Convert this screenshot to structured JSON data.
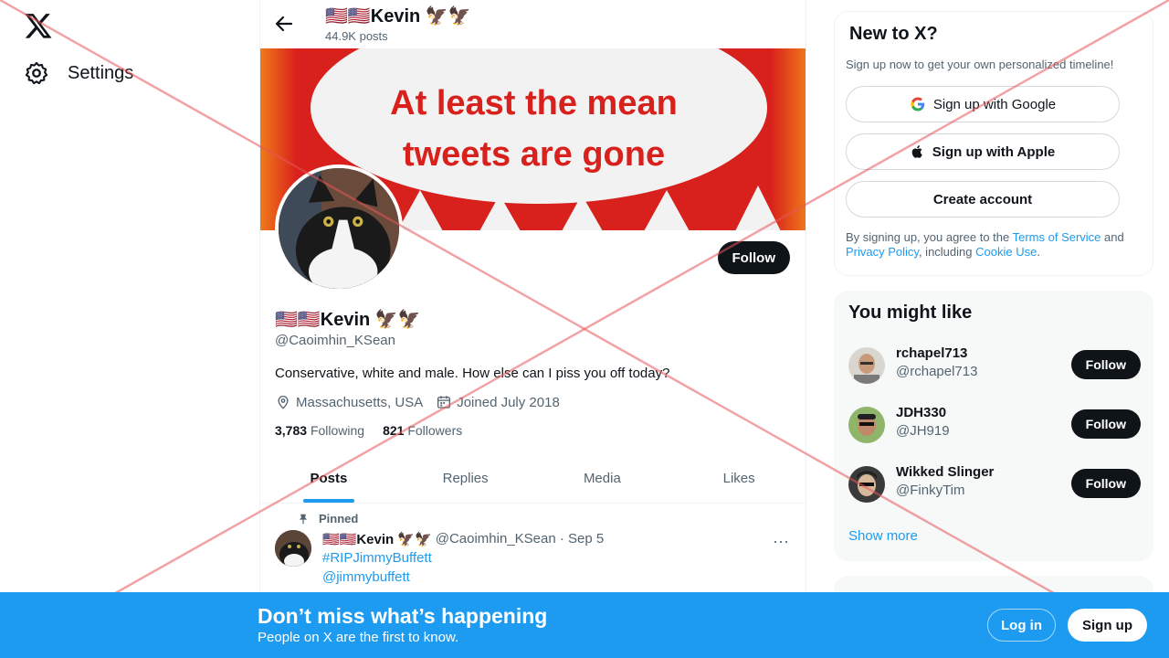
{
  "nav": {
    "settings_label": "Settings"
  },
  "header": {
    "display_name": "🇺🇸🇺🇸Kevin 🦅🦅",
    "posts_count": "44.9K posts"
  },
  "banner": {
    "text_line1": "At least the mean",
    "text_line2": "tweets are gone"
  },
  "profile": {
    "follow_label": "Follow",
    "display_name": "🇺🇸🇺🇸Kevin 🦅🦅",
    "handle": "@Caoimhin_KSean",
    "bio": "Conservative, white and male. How else can I piss you off today?",
    "location": "Massachusetts, USA",
    "joined": "Joined July 2018",
    "following_count": "3,783",
    "following_label": "Following",
    "followers_count": "821",
    "followers_label": "Followers"
  },
  "tabs": [
    {
      "label": "Posts"
    },
    {
      "label": "Replies"
    },
    {
      "label": "Media"
    },
    {
      "label": "Likes"
    }
  ],
  "tweet": {
    "pinned_label": "Pinned",
    "author_name": "🇺🇸🇺🇸Kevin 🦅🦅",
    "author_handle_date": "@Caoimhin_KSean · Sep 5",
    "more": "···",
    "line1": "#RIPJimmyBuffett",
    "line2": "@jimmybuffett"
  },
  "signup_card": {
    "title": "New to X?",
    "subtitle": "Sign up now to get your own personalized timeline!",
    "google_label": "Sign up with Google",
    "apple_label": "Sign up with Apple",
    "create_label": "Create account",
    "legal_prefix": "By signing up, you agree to the ",
    "terms": "Terms of Service",
    "and": " and ",
    "privacy": "Privacy Policy",
    "including": ", including ",
    "cookie": "Cookie Use",
    "period": "."
  },
  "suggestions": {
    "title": "You might like",
    "items": [
      {
        "name": "rchapel713",
        "handle": "@rchapel713",
        "follow": "Follow"
      },
      {
        "name": "JDH330",
        "handle": "@JH919",
        "follow": "Follow"
      },
      {
        "name": "Wikked Slinger",
        "handle": "@FinkyTim",
        "follow": "Follow"
      }
    ],
    "show_more": "Show more"
  },
  "bottom_banner": {
    "title": "Don’t miss what’s happening",
    "subtitle": "People on X are the first to know.",
    "login": "Log in",
    "signup": "Sign up"
  },
  "colors": {
    "accent": "#1d9bf0",
    "dark": "#0f1419",
    "muted": "#536471",
    "overlay_red": "#e8565a"
  }
}
